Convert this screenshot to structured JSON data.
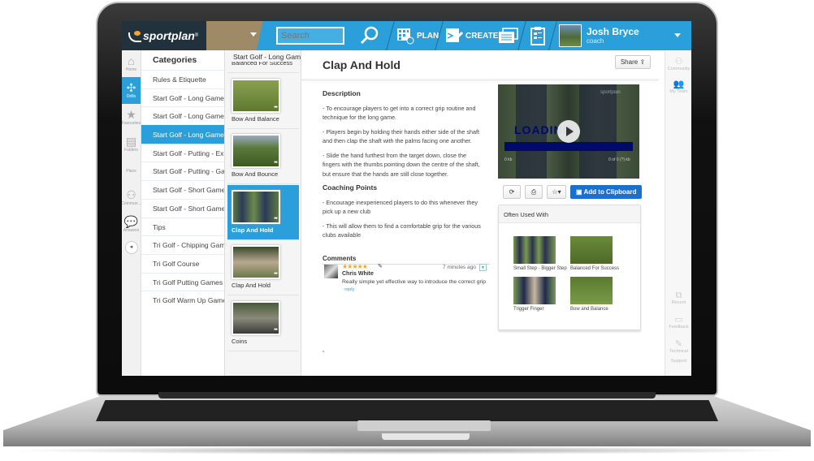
{
  "app": {
    "brand": "sportplan",
    "brand_mark": "®"
  },
  "topbar": {
    "search_placeholder": "Search",
    "nav": [
      {
        "label": "PLAN",
        "icon": "calendar-plan-icon"
      },
      {
        "label": "CREATE",
        "icon": "create-edit-icon"
      },
      {
        "label": "",
        "icon": "cards-icon"
      },
      {
        "label": "",
        "icon": "clipboard-icon"
      }
    ],
    "user": {
      "name": "Josh Bryce",
      "role": "coach"
    }
  },
  "leftnav": [
    {
      "label": "Home",
      "icon": "home-icon",
      "glyph": "⌂"
    },
    {
      "label": "Drills",
      "icon": "drills-icon",
      "glyph": "✣",
      "active": true
    },
    {
      "label": "Favourites",
      "icon": "star-icon",
      "glyph": "★"
    },
    {
      "label": "Folders",
      "icon": "folder-icon",
      "glyph": "▤"
    },
    {
      "label": "Plans",
      "icon": "plans-icon",
      "glyph": ""
    },
    {
      "label": "Commun...",
      "icon": "community-icon",
      "glyph": "⚇"
    },
    {
      "label": "Answers",
      "icon": "answers-icon",
      "glyph": "💬"
    }
  ],
  "collapse_glyph": "◂",
  "categories": {
    "title": "Categories",
    "items": [
      "Rules & Etiquette",
      "Start Golf - Long Game -",
      "Start Golf - Long Game -",
      "Start Golf - Long Game ...",
      "Start Golf - Putting - Ex...",
      "Start Golf - Putting - Ga...",
      "Start Golf - Short Game",
      "Start Golf - Short Game",
      "Tips",
      "Tri Golf - Chipping Game",
      "Tri Golf Course",
      "Tri Golf Putting Games",
      "Tri Golf Warm Up Game"
    ],
    "active_index": 3
  },
  "drills": {
    "header": "Start Golf - Long Game - Set-up",
    "items": [
      {
        "label": "Balanced For Success"
      },
      {
        "label": "Bow And Balance"
      },
      {
        "label": "Bow And Bounce"
      },
      {
        "label": "Clap And Hold",
        "active": true
      },
      {
        "label": "Clap And Hold"
      },
      {
        "label": "Coins"
      }
    ],
    "dots": "●●"
  },
  "main": {
    "title": "Clap And Hold",
    "share_label": "Share",
    "description_title": "Description",
    "description": [
      "- To encourage players to get into a correct grip routine and technique for the long game.",
      "- Players begin by holding their hands either side of the shaft and then clap the shaft with the palms facing one another.",
      "- Slide the hand furthest from the target down, close the fingers with the thumbs pointing down the centre of the shaft, but ensure that the hands are still close together."
    ],
    "coaching_title": "Coaching Points",
    "coaching": [
      "- Encourage inexperienced players to do this whenever they pick up a new club",
      "- This will allow them to find a comfortable grip for the various clubs available"
    ],
    "comments_title": "Comments",
    "comment": {
      "stars": "★★★★★",
      "rating": 5,
      "author": "Chris White",
      "time": "7 minutes ago",
      "text": "Really simple yet effective way to introduce the correct grip",
      "reply_label": "reply"
    }
  },
  "video": {
    "loading_text": "LOADING",
    "watermark": "sportplan",
    "left_caption": "0 kb",
    "right_caption": "0 of 0 (?) kb"
  },
  "tools": {
    "refresh": "⟳",
    "print": "⎙",
    "favourite": "☆▾",
    "clipboard_label": "Add to Clipboard"
  },
  "often_used": {
    "title": "Often Used With",
    "items": [
      "Small Step - Bigger Step",
      "Balanced For Success",
      "Trigger Finger",
      "Bow and Balance"
    ]
  },
  "rightnav": [
    {
      "label": "Community",
      "glyph": "⚇"
    },
    {
      "label": "My Team",
      "glyph": "👥"
    },
    {
      "label": "Recent",
      "glyph": "⧉"
    },
    {
      "label": "Feedback",
      "glyph": "▭"
    },
    {
      "label": "Technical",
      "glyph": "✎"
    },
    {
      "label": "Support",
      "glyph": ""
    }
  ]
}
